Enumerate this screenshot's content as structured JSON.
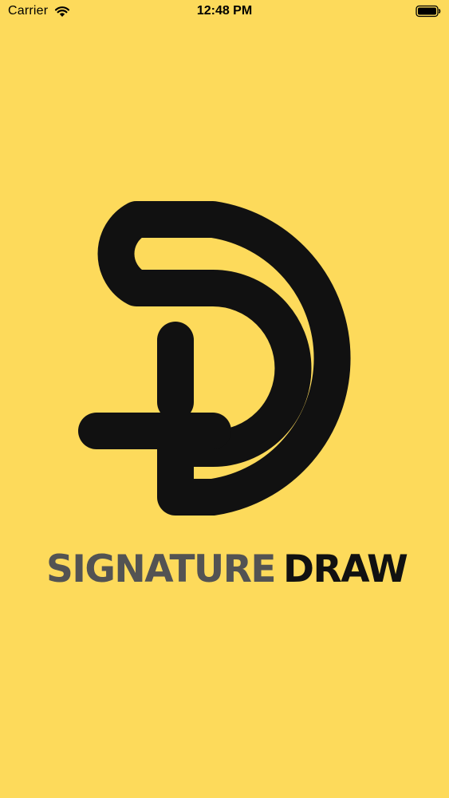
{
  "status_bar": {
    "carrier": "Carrier",
    "time": "12:48 PM",
    "wifi_icon": "wifi-icon",
    "battery_icon": "battery-full-icon"
  },
  "splash": {
    "logo_icon": "signature-draw-d-logo",
    "brand_word_1": "SIGNATURE",
    "brand_word_2": "DRAW"
  },
  "colors": {
    "background": "#FDDA5B",
    "logo": "#111111",
    "brand_word_1": "#535353",
    "brand_word_2": "#111111"
  }
}
